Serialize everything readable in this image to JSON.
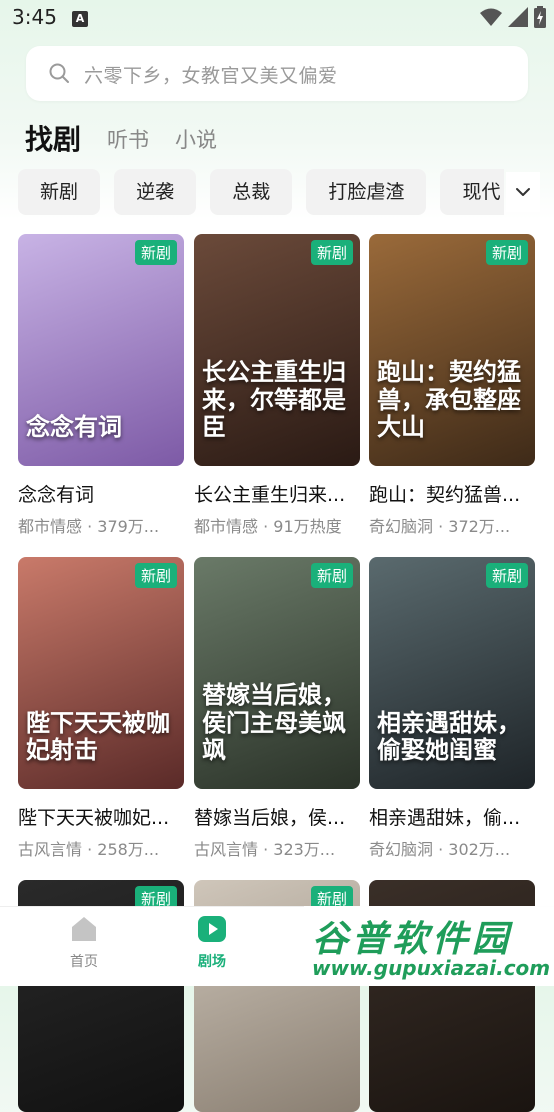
{
  "status": {
    "time": "3:45",
    "notification_icon": "A"
  },
  "search": {
    "placeholder": "六零下乡，女教官又美又偏爱"
  },
  "tabs": [
    {
      "label": "找剧",
      "active": true
    },
    {
      "label": "听书",
      "active": false
    },
    {
      "label": "小说",
      "active": false
    }
  ],
  "chips": [
    "新剧",
    "逆袭",
    "总裁",
    "打脸虐渣",
    "现代"
  ],
  "cards": [
    {
      "title": "念念有词",
      "meta": "都市情感 · 379万...",
      "badge": "新剧",
      "poster_text": "念念有词",
      "c1": "#c8b3e5",
      "c2": "#7d5aa6"
    },
    {
      "title": "长公主重生归来...",
      "meta": "都市情感 · 91万热度",
      "badge": "新剧",
      "poster_text": "长公主重生归来，尔等都是臣",
      "c1": "#6b4a3a",
      "c2": "#2a1a14"
    },
    {
      "title": "跑山：契约猛兽...",
      "meta": "奇幻脑洞 · 372万...",
      "badge": "新剧",
      "poster_text": "跑山：契约猛兽，承包整座大山",
      "c1": "#9a6a3a",
      "c2": "#3e2a18"
    },
    {
      "title": "陛下天天被咖妃...",
      "meta": "古风言情 · 258万...",
      "badge": "新剧",
      "poster_text": "陛下天天被咖妃射击",
      "c1": "#c97a6a",
      "c2": "#5a2a28"
    },
    {
      "title": "替嫁当后娘，侯...",
      "meta": "古风言情 · 323万...",
      "badge": "新剧",
      "poster_text": "替嫁当后娘，侯门主母美飒飒",
      "c1": "#6a7a68",
      "c2": "#2a3228"
    },
    {
      "title": "相亲遇甜妹，偷...",
      "meta": "奇幻脑洞 · 302万...",
      "badge": "新剧",
      "poster_text": "相亲遇甜妹，偷娶她闺蜜",
      "c1": "#5a6a6e",
      "c2": "#1e2428"
    },
    {
      "title": "",
      "meta": "",
      "badge": "新剧",
      "poster_text": "",
      "c1": "#2a2a2a",
      "c2": "#111111"
    },
    {
      "title": "",
      "meta": "",
      "badge": "新剧",
      "poster_text": "",
      "c1": "#cfc6ba",
      "c2": "#8a7f72"
    },
    {
      "title": "",
      "meta": "",
      "badge": "",
      "poster_text": "",
      "c1": "#3a2f28",
      "c2": "#1a1410"
    }
  ],
  "nav": [
    {
      "label": "首页",
      "icon": "home-icon",
      "active": false
    },
    {
      "label": "剧场",
      "icon": "play-icon",
      "active": true
    }
  ],
  "watermark": {
    "title": "谷普软件园",
    "url": "www.gupuxiazai.com"
  },
  "colors": {
    "accent": "#1ab07a",
    "inactive": "#888888"
  }
}
